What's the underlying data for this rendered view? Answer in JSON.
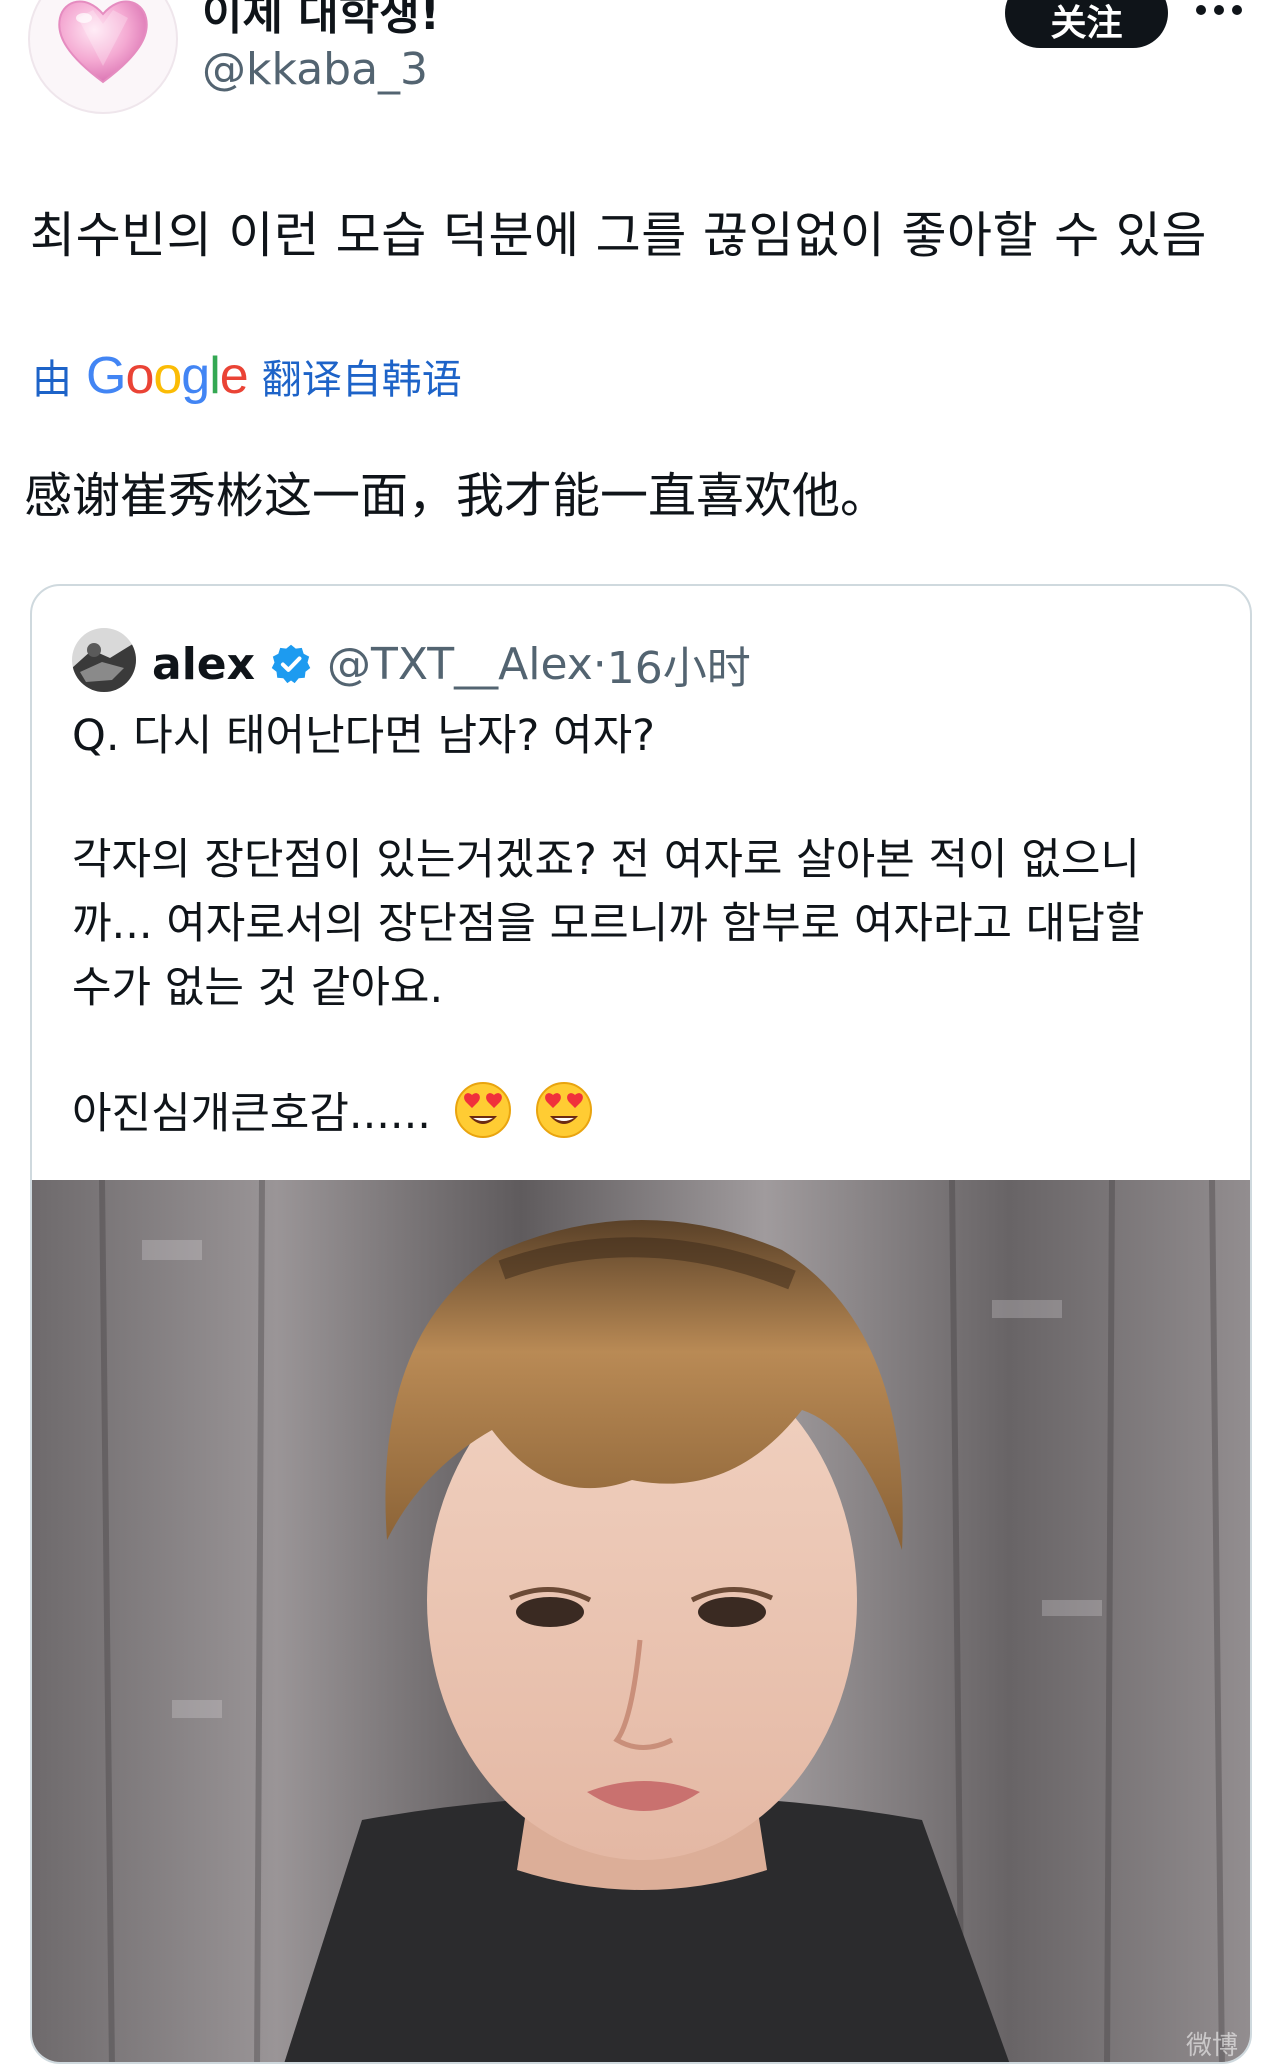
{
  "header": {
    "display_name": "이제 대학생!",
    "handle": "@kkaba_3",
    "follow_label": "关注"
  },
  "tweet": {
    "text": "최수빈의 이런 모습 덕분에 그를 끊임없이 좋아할 수 있음",
    "translation": {
      "prefix": "由",
      "provider": "Google",
      "suffix": "翻译自韩语",
      "text": "感谢崔秀彬这一面，我才能一直喜欢他。"
    }
  },
  "quote": {
    "name": "alex",
    "handle": "@TXT__Alex",
    "separator": "·",
    "time": "16小时",
    "lines": {
      "l1": "Q. 다시 태어난다면 남자? 여자?",
      "l2": "각자의 장단점이 있는거겠죠? 전 여자로 살아본 적이 없으니",
      "l3": "까... 여자로서의 장단점을 모르니까 함부로 여자라고 대답할",
      "l4": "수가 없는 것 같아요.",
      "l5": "아진심개큰호감......"
    },
    "emojis": [
      "heart-eyes-emoji",
      "heart-eyes-emoji"
    ]
  },
  "colors": {
    "text": "#0f1419",
    "muted": "#536471",
    "link_blue": "#1d63c8",
    "verified": "#1d9bf0",
    "border": "#cfd9de"
  }
}
